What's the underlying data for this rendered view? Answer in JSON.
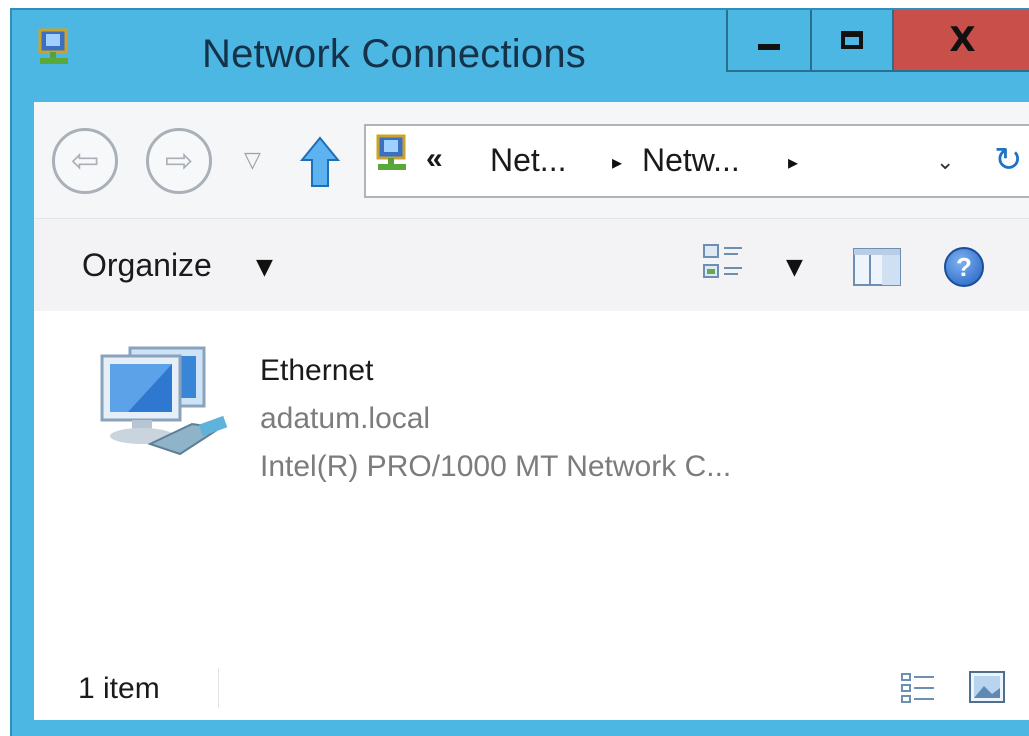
{
  "window": {
    "title": "Network Connections",
    "minimize_icon": "minimize-icon",
    "maximize_icon": "maximize-icon",
    "close_label": "X",
    "accent_color": "#4cb7e2",
    "close_color": "#c9504a"
  },
  "navigation": {
    "back_icon": "back-arrow-icon",
    "forward_icon": "forward-arrow-icon",
    "recent_icon": "chevron-down-icon",
    "up_icon": "up-arrow-icon",
    "address": {
      "overflow_label": "«",
      "crumbs": [
        "Net...",
        "Netw..."
      ],
      "separator": "▸",
      "dropdown_icon": "chevron-down-icon",
      "refresh_icon": "refresh-icon"
    }
  },
  "commandbar": {
    "organize_label": "Organize",
    "views_icon": "change-view-icon",
    "preview_pane_icon": "preview-pane-icon",
    "help_label": "?"
  },
  "items": [
    {
      "name": "Ethernet",
      "network": "adatum.local",
      "device": "Intel(R) PRO/1000 MT Network C...",
      "icon": "network-adapter-icon"
    }
  ],
  "statusbar": {
    "count": "1 item",
    "details_view_icon": "details-view-icon",
    "large_icons_view_icon": "large-icons-view-icon"
  }
}
